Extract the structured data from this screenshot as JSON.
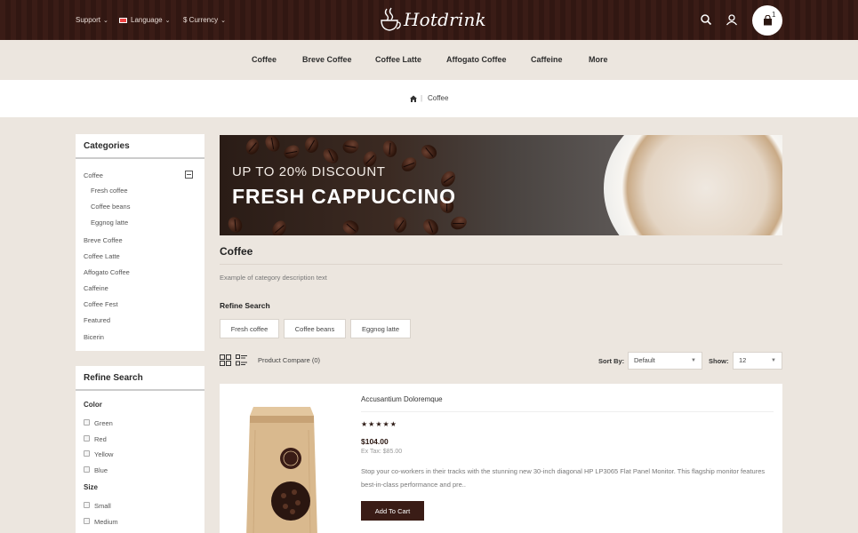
{
  "header": {
    "support": "Support",
    "language": "Language",
    "currency": "$ Currency",
    "logo_text": "Hotdrink",
    "cart_count": "1"
  },
  "nav": {
    "items": [
      "Coffee",
      "Breve Coffee",
      "Coffee Latte",
      "Affogato Coffee",
      "Caffeine",
      "More"
    ]
  },
  "breadcrumb": {
    "current": "Coffee"
  },
  "categories": {
    "title": "Categories",
    "items": [
      "Coffee",
      "Fresh coffee",
      "Coffee beans",
      "Eggnog latte",
      "Breve Coffee",
      "Coffee Latte",
      "Affogato Coffee",
      "Caffeine",
      "Coffee Fest",
      "Featured",
      "Bicerin"
    ]
  },
  "filters": {
    "title": "Refine Search",
    "color_title": "Color",
    "colors": [
      "Green",
      "Red",
      "Yellow",
      "Blue"
    ],
    "size_title": "Size",
    "sizes": [
      "Small",
      "Medium"
    ]
  },
  "banner": {
    "line1": "UP TO 20% DISCOUNT",
    "line2": "FRESH CAPPUCCINO"
  },
  "category": {
    "title": "Coffee",
    "description": "Example of category description text",
    "refine_title": "Refine Search",
    "refine_links": [
      "Fresh coffee",
      "Coffee beans",
      "Eggnog latte"
    ]
  },
  "toolbar": {
    "compare": "Product Compare (0)",
    "sort_label": "Sort By:",
    "sort_value": "Default",
    "show_label": "Show:",
    "show_value": "12"
  },
  "product": {
    "name": "Accusantium Doloremque",
    "rating": 5,
    "stars": "★★★★★",
    "price": "$104.00",
    "ex_tax": "Ex Tax: $85.00",
    "description": "Stop your co-workers in their tracks with the stunning new 30-inch diagonal HP LP3065 Flat Panel Monitor. This flagship monitor features best-in-class performance and pre..",
    "button": "Add To Cart"
  },
  "colors": {
    "brand_dark": "#3a1c16",
    "page_bg": "#ece6df"
  }
}
